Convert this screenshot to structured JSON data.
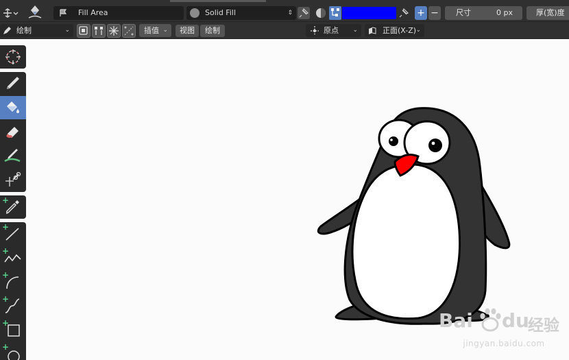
{
  "header": {
    "fill_mode": {
      "label": "Fill Area"
    },
    "fill_style": {
      "label": "Solid Fill"
    },
    "fill_color": "#0000ff",
    "size": {
      "label": "尺寸",
      "value": "0 px"
    },
    "thickness": {
      "label": "厚(宽)度"
    },
    "plus_label": "+",
    "minus_label": "−"
  },
  "subheader": {
    "mode": {
      "label": "绘制"
    },
    "interpolate": {
      "label": "插值"
    },
    "view_button": "视图",
    "draw_button": "绘制",
    "origin": {
      "label": "原点"
    },
    "plane": {
      "label": "正面(X-Z)"
    }
  },
  "toolbar": {
    "active_tool": "fill-tool",
    "tools": [
      {
        "name": "cursor-tool",
        "icon": "cursor-icon"
      },
      {
        "name": "draw-tool",
        "icon": "pencil-icon"
      },
      {
        "name": "fill-tool",
        "icon": "paint-bucket-icon"
      },
      {
        "name": "erase-tool",
        "icon": "eraser-icon"
      },
      {
        "name": "tint-tool",
        "icon": "tint-brush-icon"
      },
      {
        "name": "cutter-tool",
        "icon": "scissors-icon"
      },
      {
        "name": "eyedropper-tool",
        "icon": "eyedropper-icon"
      },
      {
        "name": "line-tool",
        "icon": "line-icon"
      },
      {
        "name": "polyline-tool",
        "icon": "polyline-icon"
      },
      {
        "name": "arc-tool",
        "icon": "arc-icon"
      },
      {
        "name": "curve-tool",
        "icon": "curve-icon"
      },
      {
        "name": "box-tool",
        "icon": "box-icon"
      },
      {
        "name": "circle-tool",
        "icon": "circle-icon"
      }
    ]
  },
  "canvas": {
    "body_color": "#333333",
    "belly_color": "#ffffff",
    "beak_color": "#ff0000",
    "outline_color": "#000000"
  },
  "watermark": {
    "logo_text": "Bai",
    "logo_text2": "du",
    "suffix": "经验",
    "url": "jingyan.baidu.com"
  }
}
